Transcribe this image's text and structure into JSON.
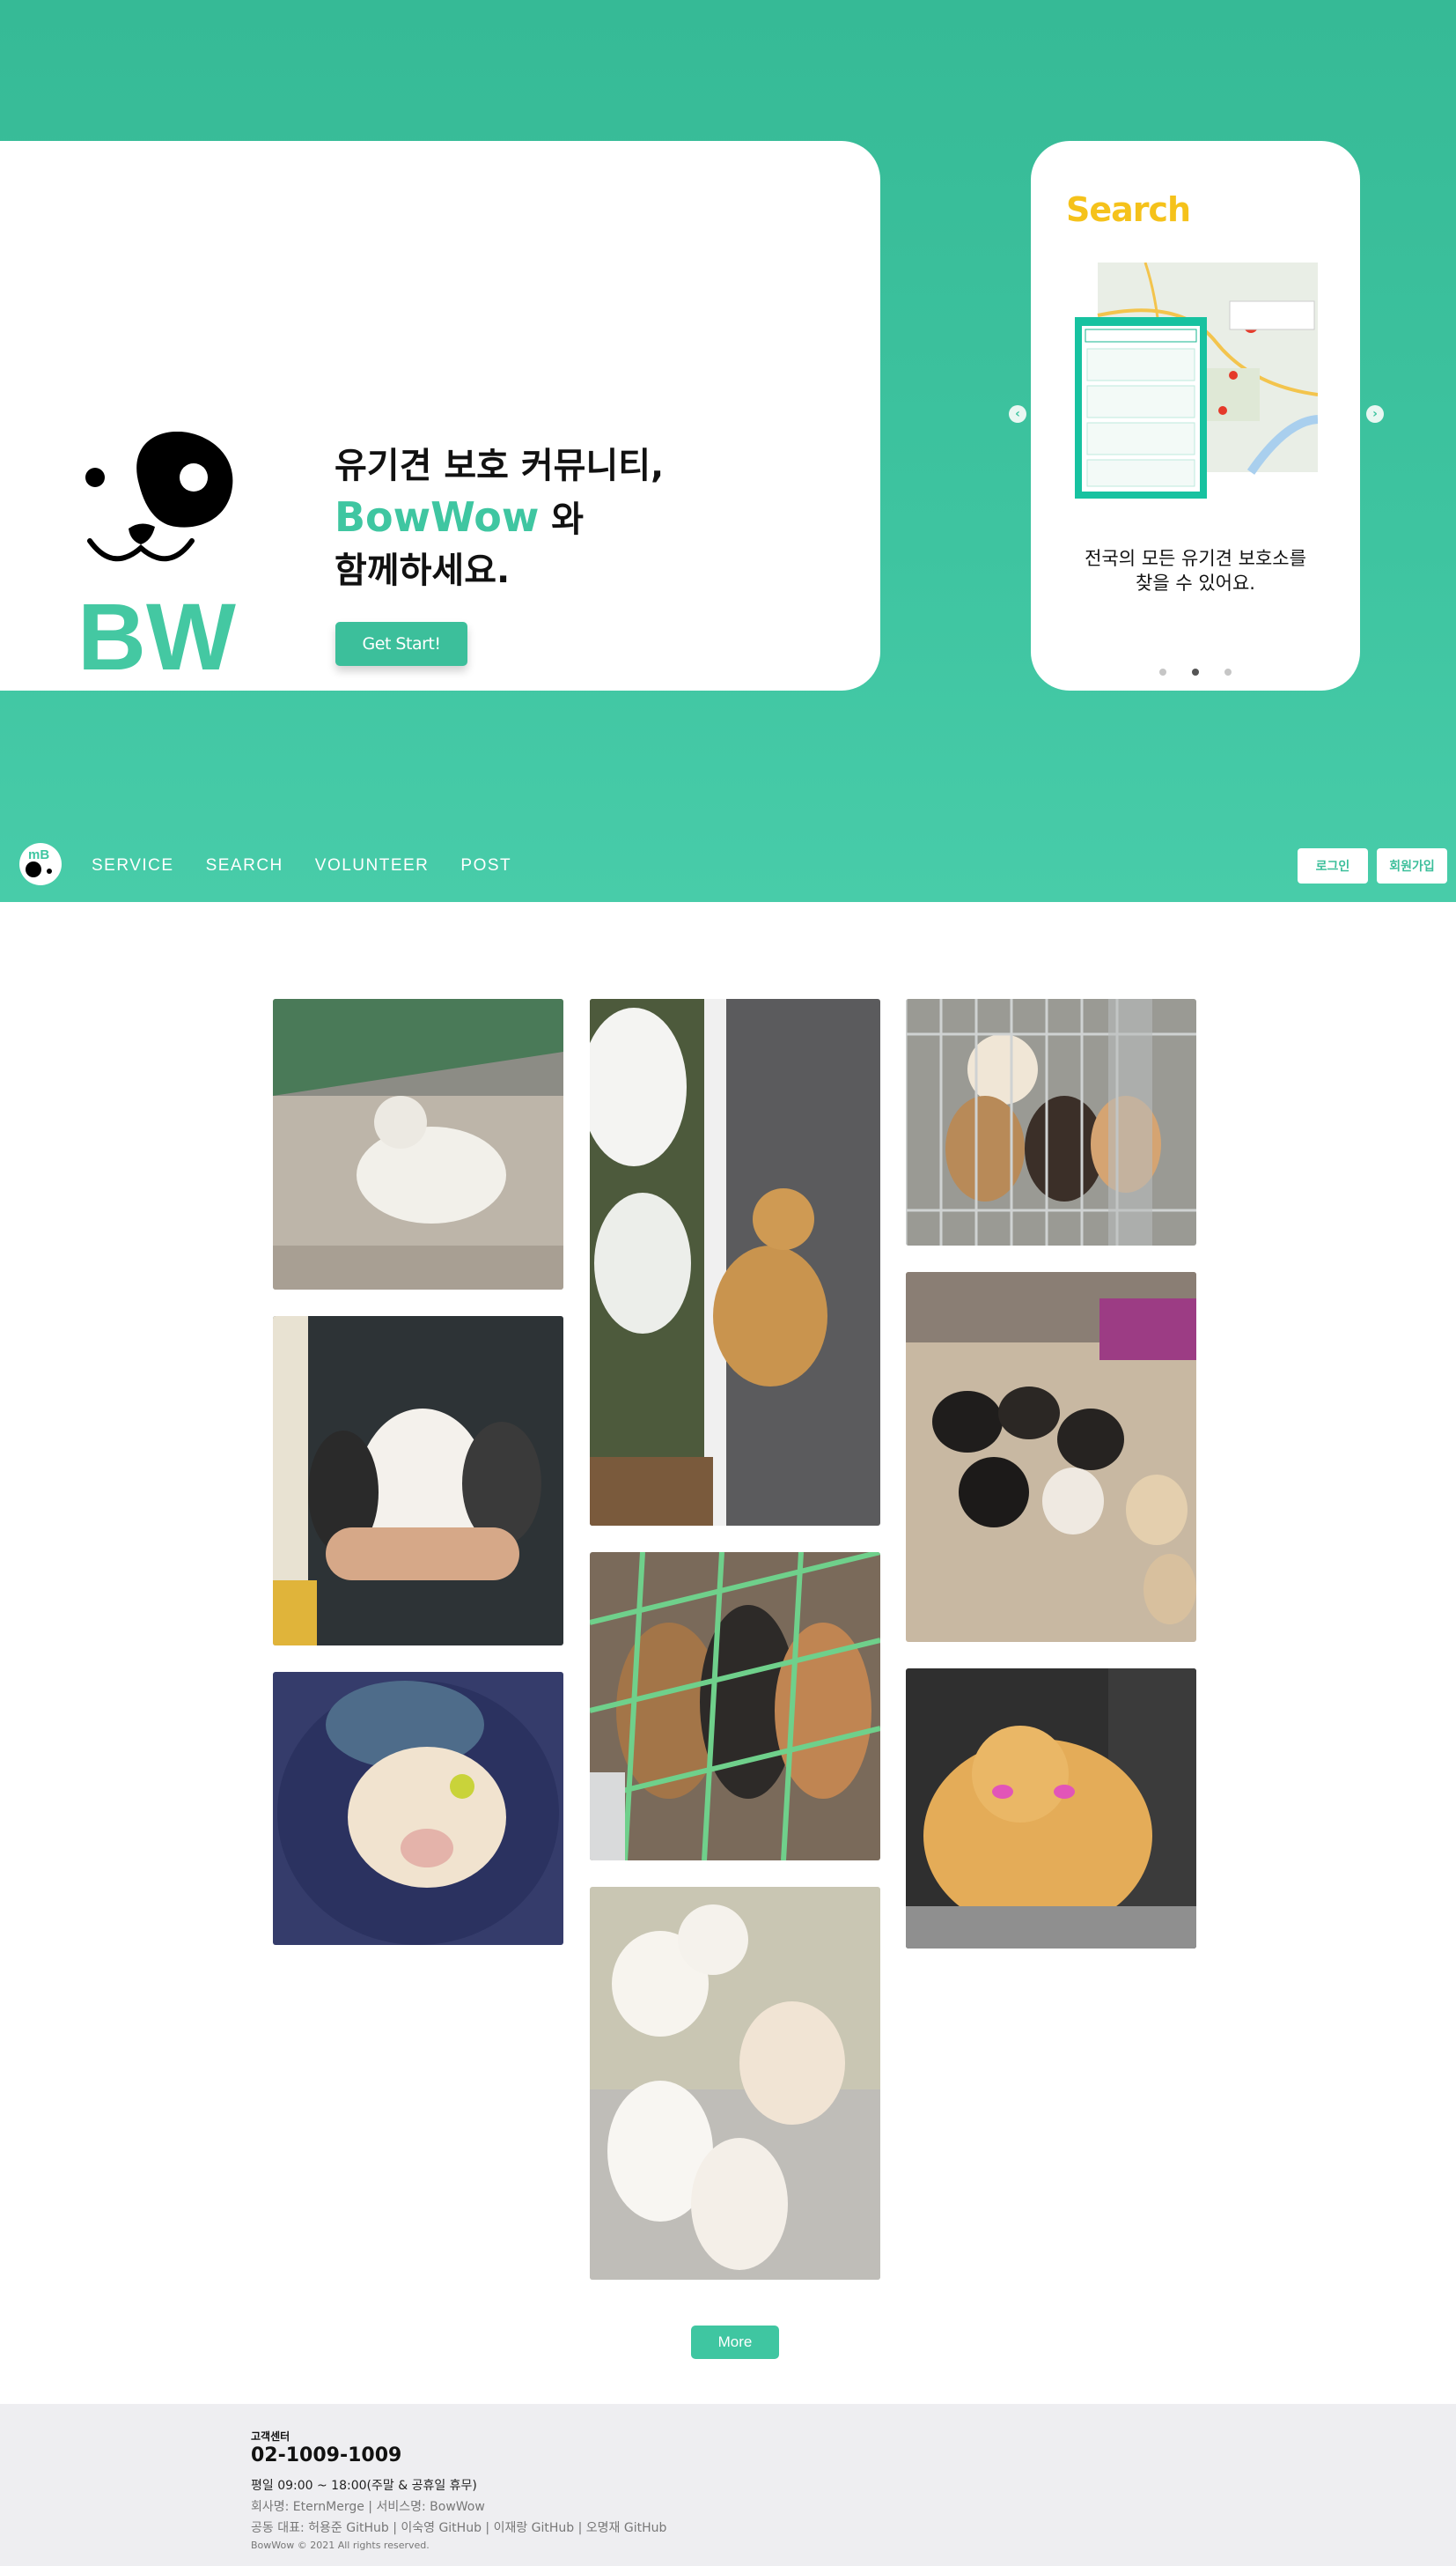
{
  "hero": {
    "headline_line1": "유기견 보호 커뮤니티,",
    "headline_brand": "BowWow",
    "headline_brand_suffix": " 와",
    "headline_line3": "함께하세요.",
    "start_button": "Get Start!",
    "logo_text": "BW"
  },
  "slider": {
    "title": "Search",
    "caption_line1": "전국의 모든 유기견 보호소를",
    "caption_line2": "찾을 수 있어요.",
    "active_index": 1,
    "slide_count": 3,
    "prev_icon": "chevron-left-icon",
    "next_icon": "chevron-right-icon"
  },
  "nav": {
    "logo_text": "mB",
    "links": [
      "SERVICE",
      "SEARCH",
      "VOLUNTEER",
      "POST"
    ],
    "login": "로그인",
    "signup": "회원가입"
  },
  "gallery": {
    "more_label": "More",
    "photos": [
      "small white fluffy dog on pavement",
      "shiba dog sitting by white flowers",
      "puppies in a metal cage",
      "person holding three puppies",
      "many dogs in a dirt yard",
      "puppy sleeping in a blue bed",
      "dogs behind green fence",
      "pomeranian dog",
      "white puppies on the floor"
    ]
  },
  "footer": {
    "label": "고객센터",
    "phone": "02-1009-1009",
    "hours": "평일 09:00 ~ 18:00(주말 & 공휴일 휴무)",
    "company": "회사명: EternMerge | 서비스명: BowWow",
    "representatives": "공동 대표: 허용준 GitHub | 이숙영 GitHub | 이재랑 GitHub | 오명재 GitHub",
    "copyright": "BowWow © 2021 All rights reserved."
  },
  "colors": {
    "brand": "#3fc6a1",
    "hero_bg": "#3ec4a0",
    "search_title": "#f5c21b",
    "footer_bg": "#eeeef1"
  }
}
